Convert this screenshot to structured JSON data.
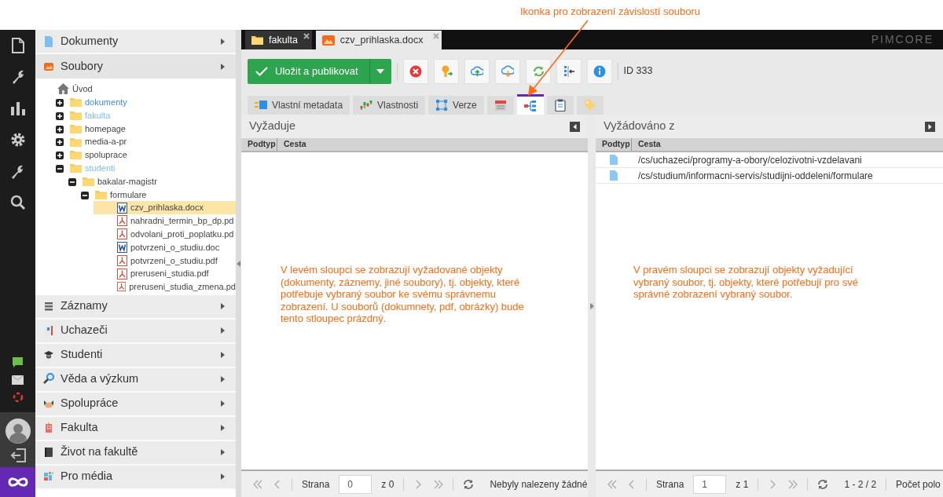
{
  "annotation": "Ikonka pro zobrazení závislostí souboru",
  "sidebar": {
    "sections": [
      {
        "label": "Dokumenty",
        "expanded": false
      },
      {
        "label": "Soubory",
        "expanded": true,
        "tree": {
          "label": "Úvod",
          "kind": "home",
          "selected": false,
          "color": "#444444",
          "children": [
            {
              "label": "dokumenty",
              "kind": "folder",
              "expanded": false,
              "selected": false,
              "color": "#3d8ee0"
            },
            {
              "label": "fakulta",
              "kind": "folder",
              "expanded": false,
              "selected": false,
              "color": "#7fbdf0"
            },
            {
              "label": "homepage",
              "kind": "folder",
              "expanded": false,
              "selected": false,
              "color": "#444444"
            },
            {
              "label": "media-a-pr",
              "kind": "folder",
              "expanded": false,
              "selected": false,
              "color": "#444444"
            },
            {
              "label": "spoluprace",
              "kind": "folder",
              "expanded": false,
              "selected": false,
              "color": "#444444"
            },
            {
              "label": "studenti",
              "kind": "folder",
              "expanded": true,
              "selected": false,
              "color": "#7fbdf0",
              "children": [
                {
                  "label": "bakalar-magistr",
                  "kind": "folder",
                  "expanded": true,
                  "selected": false,
                  "color": "#444444",
                  "children": [
                    {
                      "label": "formulare",
                      "kind": "folder",
                      "expanded": true,
                      "selected": false,
                      "color": "#444444",
                      "children": [
                        {
                          "label": "czv_prihlaska.docx",
                          "kind": "word",
                          "selected": true
                        },
                        {
                          "label": "nahradni_termin_bp_dp.pd",
                          "kind": "pdf",
                          "selected": false
                        },
                        {
                          "label": "odvolani_proti_poplatku.pd",
                          "kind": "pdf",
                          "selected": false
                        },
                        {
                          "label": "potvrzeni_o_studiu.doc",
                          "kind": "word",
                          "selected": false
                        },
                        {
                          "label": "potvrzeni_o_studiu.pdf",
                          "kind": "pdf",
                          "selected": false
                        },
                        {
                          "label": "preruseni_studia.pdf",
                          "kind": "pdf",
                          "selected": false
                        },
                        {
                          "label": "preruseni_studia_zmena.pd",
                          "kind": "pdf",
                          "selected": false
                        }
                      ]
                    }
                  ]
                }
              ]
            }
          ]
        }
      },
      {
        "label": "Záznamy",
        "expanded": false
      },
      {
        "label": "Uchazeči",
        "expanded": false
      },
      {
        "label": "Studenti",
        "expanded": false
      },
      {
        "label": "Věda a výzkum",
        "expanded": false
      },
      {
        "label": "Spolupráce",
        "expanded": false
      },
      {
        "label": "Fakulta",
        "expanded": false
      },
      {
        "label": "Život na fakultě",
        "expanded": false
      },
      {
        "label": "Pro média",
        "expanded": false
      }
    ]
  },
  "editor_tabs": [
    {
      "label": "fakulta",
      "kind": "folder",
      "selected": false
    },
    {
      "label": "czv_prihlaska.docx",
      "kind": "image",
      "selected": true
    }
  ],
  "brand": "PIMCORE",
  "toolbar": {
    "save_label": "Uložit a publikovat",
    "id_label": "ID 333"
  },
  "subtabs": [
    {
      "label": "Vlastní metadata",
      "selected": false
    },
    {
      "label": "Vlastnosti",
      "selected": false
    },
    {
      "label": "Verze",
      "selected": false
    },
    {
      "selected": false
    },
    {
      "selected": true
    },
    {
      "selected": false
    },
    {
      "selected": false
    }
  ],
  "panels": [
    {
      "title": "Vyžaduje",
      "columns": [
        "Podtyp",
        "Cesta"
      ],
      "note": "V levém sloupci se zobrazují vyžadované objekty (dokumenty, záznemy, jiné soubory), tj. objekty, které potřebuje vybraný soubor ke svému správnemu zobrazení. U souborů (dokumnety, pdf, obrázky) bude tento stloupec prázdný.",
      "pager": {
        "page_label": "Strana",
        "page": "0",
        "total": "z 0",
        "status": "Nebyly nalezeny žádné"
      }
    },
    {
      "title": "Vyžádováno z",
      "columns": [
        "Podtyp",
        "Cesta"
      ],
      "rows": [
        {
          "path": "/cs/uchazeci/programy-a-obory/celozivotni-vzdelavani"
        },
        {
          "path": "/cs/studium/informacni-servis/studijni-oddeleni/formulare"
        }
      ],
      "note": "V pravém sloupci se zobrazují objekty vyžadující vybraný soubor, tj. objekty, které potřebují pro své správné zobrazení vybraný soubor.",
      "pager": {
        "page_label": "Strana",
        "page": "1",
        "total": "z 1",
        "status": "1 - 2 / 2",
        "extra": "Počet polo"
      }
    }
  ]
}
